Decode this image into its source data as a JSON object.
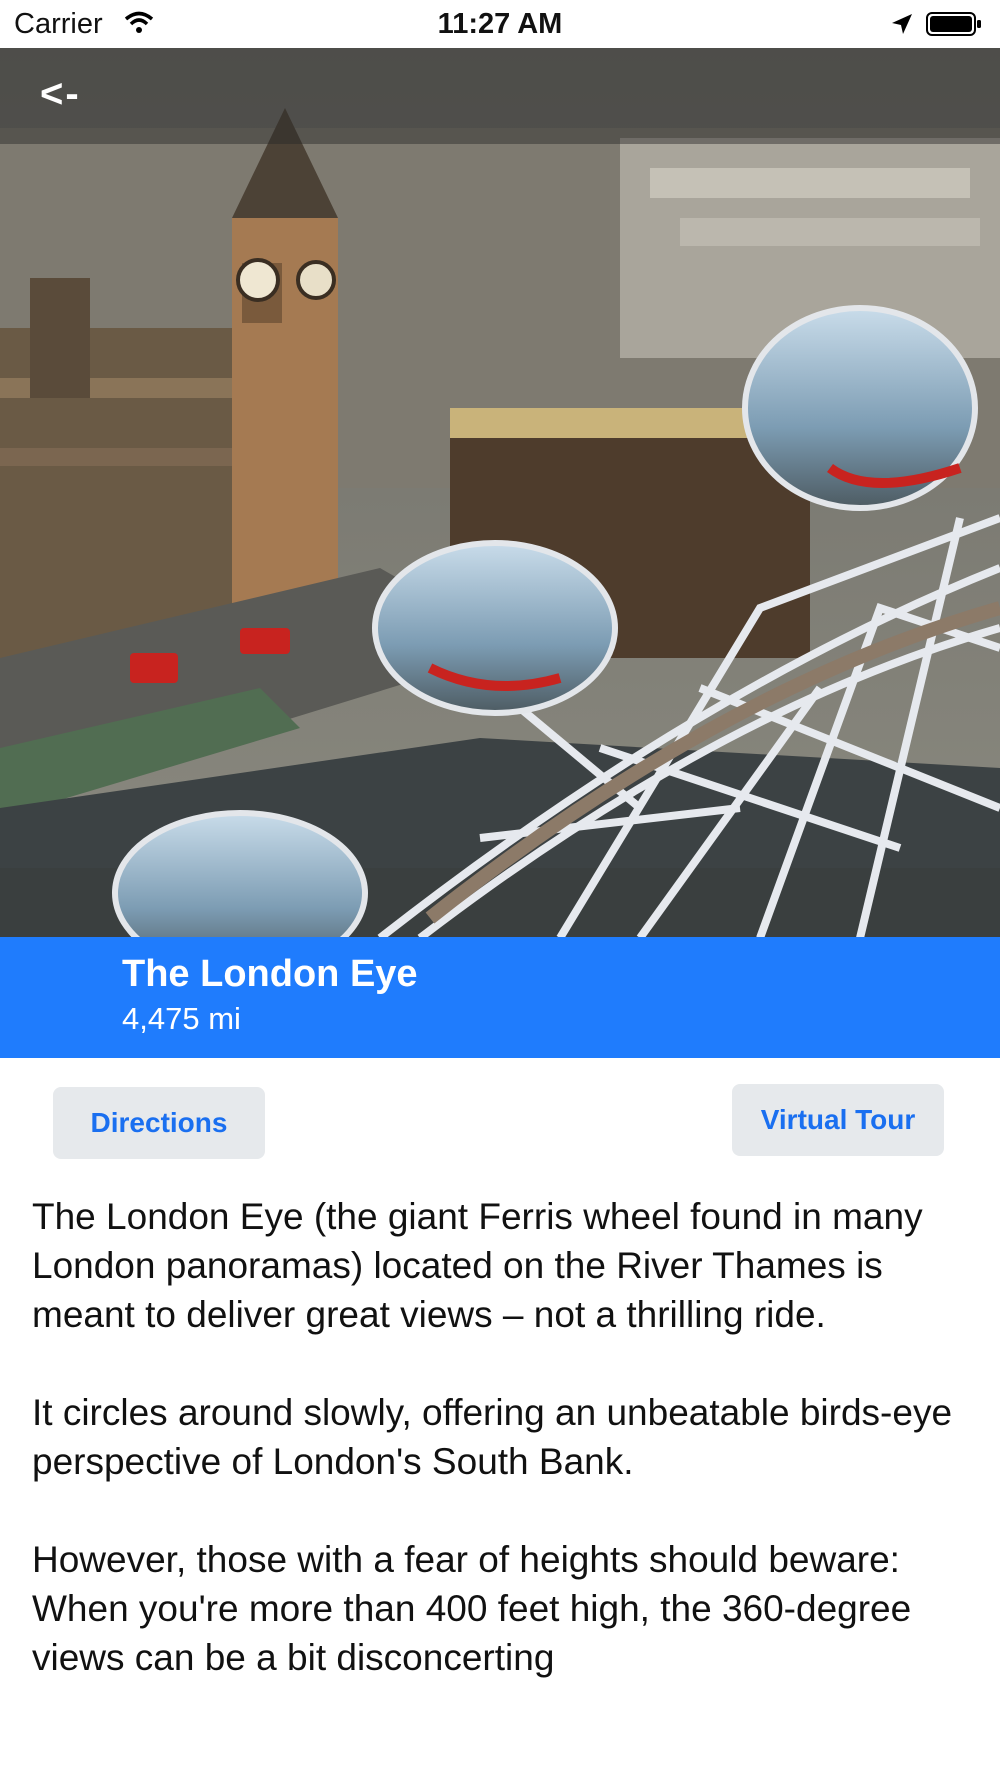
{
  "status_bar": {
    "carrier": "Carrier",
    "time": "11:27 AM",
    "icons": [
      "wifi-icon",
      "location-arrow-icon",
      "battery-icon"
    ]
  },
  "nav": {
    "back_label": "<-"
  },
  "hero_image": {
    "subject": "London Eye capsules over Westminster and Big Ben"
  },
  "place": {
    "name": "The London Eye",
    "distance": "4,475 mi"
  },
  "actions": {
    "directions_label": "Directions",
    "virtual_tour_label": "Virtual Tour"
  },
  "description": {
    "paragraphs": [
      "The London Eye (the giant Ferris wheel found in many London panoramas) located on the River Thames is meant to deliver great views – not a thrilling ride.",
      "It circles around slowly, offering an unbeatable birds-eye perspective of London's South Bank.",
      "However, those with a fear of heights should beware: When you're more than 400 feet high, the 360-degree views can be a bit disconcerting"
    ]
  },
  "colors": {
    "accent": "#1f7cfd",
    "button_bg": "#e6e9ec",
    "button_text": "#1a6ff0"
  }
}
